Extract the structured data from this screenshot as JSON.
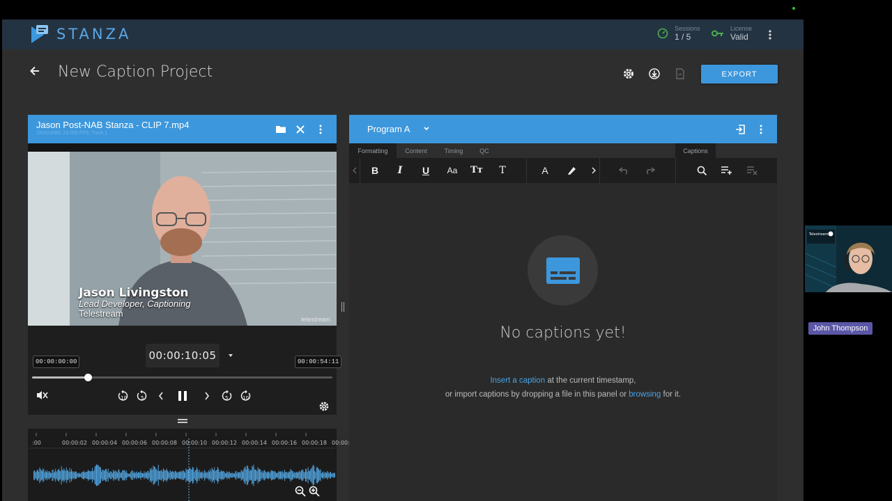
{
  "app": {
    "brand": "STANZA",
    "sessions_label": "Sessions",
    "sessions_value": "1 / 5",
    "license_label": "License",
    "license_value": "Valid"
  },
  "page": {
    "title": "New Caption Project",
    "export_label": "EXPORT"
  },
  "media_panel": {
    "file_name": "Jason Post-NAB Stanza - CLIP 7.mp4",
    "file_info": "1920x1080, 24.000 FPS, Track 1",
    "video_overlay": {
      "name": "Jason Livingston",
      "role": "Lead Developer, Captioning",
      "company": "Telestream",
      "watermark": "telestream"
    },
    "start_time": "00:00:00:00",
    "current_time": "00:00:10:05",
    "end_time": "00:00:54:11",
    "progress": 0.186,
    "ruler_labels": [
      ":00",
      "00:00:02",
      "00:00:04",
      "00:00:06",
      "00:00:08",
      "00:00:10",
      "00:00:12",
      "00:00:14",
      "00:00:16",
      "00:00:18",
      "00:00:"
    ]
  },
  "captions_panel": {
    "program": "Program A",
    "tabs": [
      "Formatting",
      "Content",
      "Timing",
      "QC"
    ],
    "right_tab": "Captions",
    "empty_title": "No captions yet!",
    "insert_link": "Insert a caption",
    "insert_suffix": "at the current timestamp,",
    "import_prefix": "or import captions by dropping a file in this panel or",
    "browse_link": "browsing",
    "import_suffix": "for it."
  },
  "participant": {
    "name": "John Thompson"
  },
  "colors": {
    "accent": "#3d97dc",
    "topbar": "#243342",
    "background": "#2e2e2e",
    "name_tag": "#5b57a6"
  }
}
